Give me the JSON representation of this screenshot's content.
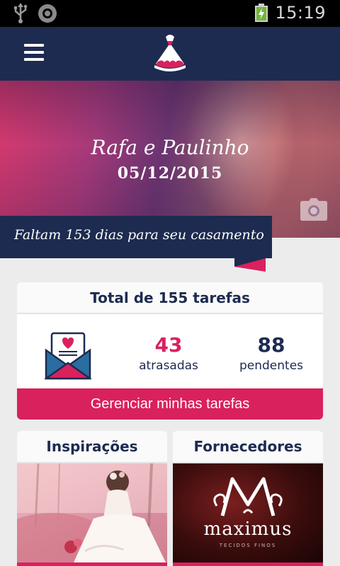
{
  "status_bar": {
    "time": "15:19",
    "icons": [
      "usb-icon",
      "notification-icon",
      "battery-charging-icon"
    ]
  },
  "app_bar": {
    "menu_icon": "hamburger-menu-icon",
    "logo_icon": "wedding-dress-logo-icon"
  },
  "hero": {
    "couple_names": "Rafa e Paulinho",
    "wedding_date": "05/12/2015",
    "camera_icon": "camera-icon"
  },
  "countdown": {
    "text": "Faltam 153 dias para seu casamento"
  },
  "tasks": {
    "title": "Total de 155 tarefas",
    "icon": "love-letter-envelope-icon",
    "late_count": "43",
    "late_label": "atrasadas",
    "pending_count": "88",
    "pending_label": "pendentes",
    "manage_button": "Gerenciar minhas tarefas"
  },
  "cards": {
    "inspiracoes": {
      "title": "Inspirações"
    },
    "fornecedores": {
      "title": "Fornecedores",
      "brand_name": "maximus",
      "brand_subtitle": "TECIDOS FINOS"
    }
  },
  "colors": {
    "navy": "#1d2b50",
    "accent": "#d9215d",
    "background": "#ececec"
  }
}
